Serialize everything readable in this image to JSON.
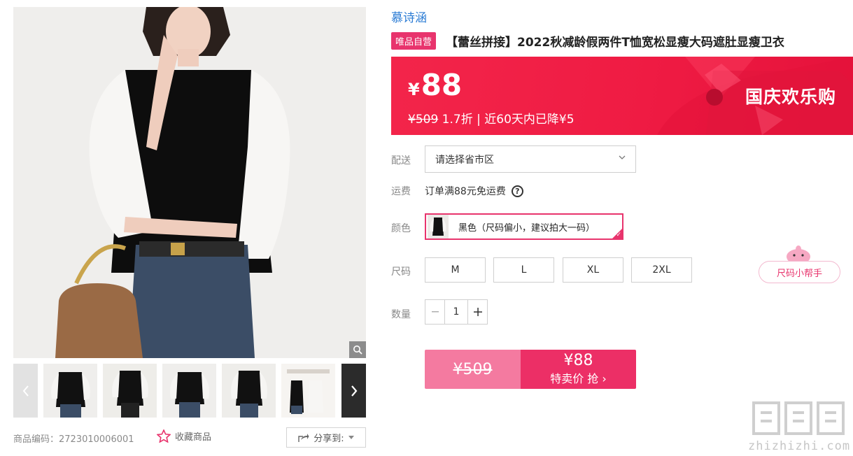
{
  "brand": "慕诗涵",
  "badge": "唯品自营",
  "title": "【蕾丝拼接】2022秋减龄假两件T恤宽松显瘦大码遮肚显瘦卫衣",
  "price": {
    "yen": "¥",
    "value": "88",
    "original": "¥509",
    "discount": "1.7折",
    "drop_note": "| 近60天内已降¥5",
    "promo": "国庆欢乐购"
  },
  "delivery": {
    "label": "配送",
    "placeholder": "请选择省市区"
  },
  "shipping": {
    "label": "运费",
    "text": "订单满88元免运费"
  },
  "color": {
    "label": "颜色",
    "selected": "黑色（尺码偏小，建议拍大一码）"
  },
  "size": {
    "label": "尺码",
    "options": [
      "M",
      "L",
      "XL",
      "2XL"
    ],
    "helper": "尺码小帮手"
  },
  "quantity": {
    "label": "数量",
    "value": "1"
  },
  "buy": {
    "original": "¥509",
    "price": "¥88",
    "action": "特卖价 抢"
  },
  "sku": "商品编码：2723010006001",
  "favorite": "收藏商品",
  "share": "分享到:",
  "watermark": "zhizhizhi.com",
  "colors": {
    "accent": "#e8346d",
    "banner": "#f3254a",
    "brand_link": "#2a7bd4"
  }
}
